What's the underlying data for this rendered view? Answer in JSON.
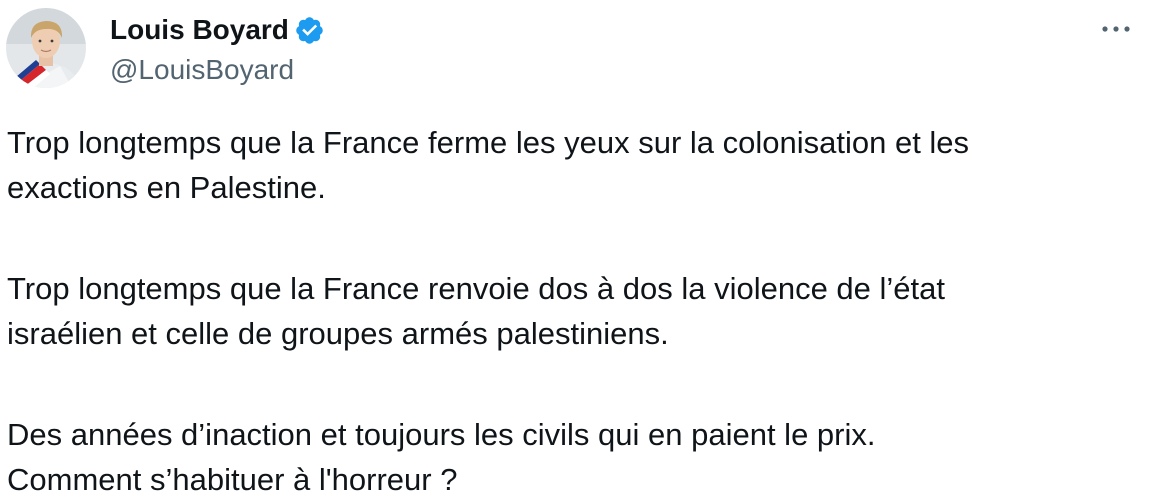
{
  "author": {
    "display_name": "Louis Boyard",
    "handle": "@LouisBoyard",
    "verified": true,
    "verified_badge_color": "#1d9bf0",
    "avatar_icon": "profile-photo"
  },
  "menu": {
    "more_icon": "more-horizontal-icon"
  },
  "tweet": {
    "paragraphs": [
      {
        "lines": [
          "Trop longtemps que la France ferme les yeux sur la colonisation et les",
          "exactions en Palestine."
        ]
      },
      {
        "lines": [
          "Trop longtemps que la France renvoie dos à dos la violence de l’état",
          "israélien et celle de groupes armés palestiniens."
        ]
      },
      {
        "lines": [
          "Des années d’inaction et toujours les civils qui en paient le prix.",
          "Comment s’habituer à l'horreur ?"
        ]
      }
    ]
  },
  "colors": {
    "text_primary": "#0f1419",
    "text_secondary": "#536471",
    "background": "#ffffff"
  }
}
